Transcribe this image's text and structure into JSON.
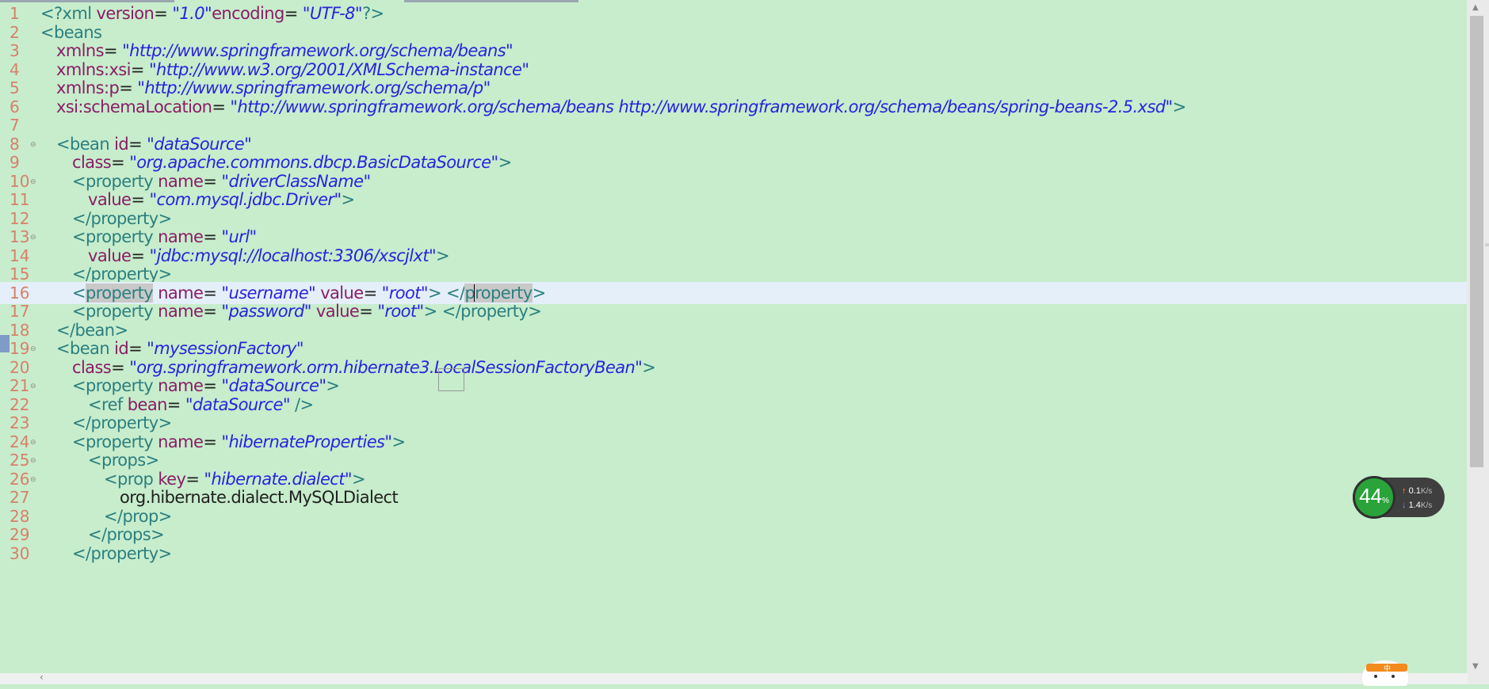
{
  "editor": {
    "lines": [
      {
        "n": "1",
        "fold": false,
        "current": false,
        "indent": 0,
        "tokens": [
          [
            "t",
            "<?xml "
          ],
          [
            "a",
            "version"
          ],
          [
            "x",
            "= "
          ],
          [
            "v",
            "\"1.0\""
          ],
          [
            "a",
            "encoding"
          ],
          [
            "x",
            "= "
          ],
          [
            "v",
            "\"UTF-8\""
          ],
          [
            "t",
            "?>"
          ]
        ]
      },
      {
        "n": "2",
        "fold": false,
        "current": false,
        "indent": 0,
        "tokens": [
          [
            "t",
            "<beans"
          ]
        ]
      },
      {
        "n": "3",
        "fold": false,
        "current": false,
        "indent": 1,
        "tokens": [
          [
            "a",
            "xmlns"
          ],
          [
            "x",
            "= "
          ],
          [
            "v",
            "\"http://www.springframework.org/schema/beans\""
          ]
        ]
      },
      {
        "n": "4",
        "fold": false,
        "current": false,
        "indent": 1,
        "tokens": [
          [
            "a",
            "xmlns:xsi"
          ],
          [
            "x",
            "= "
          ],
          [
            "v",
            "\"http://www.w3.org/2001/XMLSchema-instance\""
          ]
        ]
      },
      {
        "n": "5",
        "fold": false,
        "current": false,
        "indent": 1,
        "tokens": [
          [
            "a",
            "xmlns:p"
          ],
          [
            "x",
            "= "
          ],
          [
            "v",
            "\"http://www.springframework.org/schema/p\""
          ]
        ]
      },
      {
        "n": "6",
        "fold": false,
        "current": false,
        "indent": 1,
        "tokens": [
          [
            "a",
            "xsi:schemaLocation"
          ],
          [
            "x",
            "= "
          ],
          [
            "v",
            "\"http://www.springframework.org/schema/beans http://www.springframework.org/schema/beans/spring-beans-2.5.xsd\""
          ],
          [
            "t",
            ">"
          ]
        ]
      },
      {
        "n": "7",
        "fold": false,
        "current": false,
        "indent": 0,
        "tokens": []
      },
      {
        "n": "8",
        "fold": true,
        "current": false,
        "indent": 1,
        "tokens": [
          [
            "t",
            "<bean "
          ],
          [
            "a",
            "id"
          ],
          [
            "x",
            "= "
          ],
          [
            "v",
            "\"dataSource\""
          ]
        ]
      },
      {
        "n": "9",
        "fold": false,
        "current": false,
        "indent": 2,
        "tokens": [
          [
            "a",
            "class"
          ],
          [
            "x",
            "= "
          ],
          [
            "v",
            "\"org.apache.commons.dbcp.BasicDataSource\""
          ],
          [
            "t",
            ">"
          ]
        ]
      },
      {
        "n": "10",
        "fold": true,
        "current": false,
        "indent": 2,
        "tokens": [
          [
            "t",
            "<property "
          ],
          [
            "a",
            "name"
          ],
          [
            "x",
            "= "
          ],
          [
            "v",
            "\"driverClassName\""
          ]
        ]
      },
      {
        "n": "11",
        "fold": false,
        "current": false,
        "indent": 3,
        "tokens": [
          [
            "a",
            "value"
          ],
          [
            "x",
            "= "
          ],
          [
            "v",
            "\"com.mysql.jdbc.Driver\""
          ],
          [
            "t",
            ">"
          ]
        ]
      },
      {
        "n": "12",
        "fold": false,
        "current": false,
        "indent": 2,
        "tokens": [
          [
            "t",
            "</property>"
          ]
        ]
      },
      {
        "n": "13",
        "fold": true,
        "current": false,
        "indent": 2,
        "tokens": [
          [
            "t",
            "<property "
          ],
          [
            "a",
            "name"
          ],
          [
            "x",
            "= "
          ],
          [
            "v",
            "\"url\""
          ]
        ]
      },
      {
        "n": "14",
        "fold": false,
        "current": false,
        "indent": 3,
        "tokens": [
          [
            "a",
            "value"
          ],
          [
            "x",
            "= "
          ],
          [
            "v",
            "\"jdbc:mysql://localhost:3306/xscjlxt\""
          ],
          [
            "t",
            ">"
          ]
        ]
      },
      {
        "n": "15",
        "fold": false,
        "current": false,
        "indent": 2,
        "tokens": [
          [
            "t",
            "</property>"
          ]
        ]
      },
      {
        "n": "16",
        "fold": false,
        "current": true,
        "indent": 2,
        "tokens": [
          [
            "t",
            "<"
          ],
          [
            "th",
            "property"
          ],
          [
            "t",
            " "
          ],
          [
            "a",
            "name"
          ],
          [
            "x",
            "= "
          ],
          [
            "v",
            "\"username\""
          ],
          [
            "t",
            " "
          ],
          [
            "a",
            "value"
          ],
          [
            "x",
            "= "
          ],
          [
            "v",
            "\"root\""
          ],
          [
            "t",
            "> </"
          ],
          [
            "th",
            "p"
          ],
          [
            "caret",
            ""
          ],
          [
            "th",
            "roperty"
          ],
          [
            "t",
            ">"
          ]
        ]
      },
      {
        "n": "17",
        "fold": false,
        "current": false,
        "indent": 2,
        "tokens": [
          [
            "t",
            "<property "
          ],
          [
            "a",
            "name"
          ],
          [
            "x",
            "= "
          ],
          [
            "v",
            "\"password\""
          ],
          [
            "t",
            " "
          ],
          [
            "a",
            "value"
          ],
          [
            "x",
            "= "
          ],
          [
            "v",
            "\"root\""
          ],
          [
            "t",
            "> </property>"
          ]
        ]
      },
      {
        "n": "18",
        "fold": false,
        "current": false,
        "indent": 1,
        "tokens": [
          [
            "t",
            "</bean>"
          ]
        ]
      },
      {
        "n": "19",
        "fold": true,
        "current": false,
        "indent": 1,
        "tokens": [
          [
            "t",
            "<bean "
          ],
          [
            "a",
            "id"
          ],
          [
            "x",
            "= "
          ],
          [
            "v",
            "\"mysessionFactory\""
          ]
        ]
      },
      {
        "n": "20",
        "fold": false,
        "current": false,
        "indent": 2,
        "tokens": [
          [
            "a",
            "class"
          ],
          [
            "x",
            "= "
          ],
          [
            "v",
            "\"org.springframework.orm.hibernate3.LocalSessionFactoryBean\""
          ],
          [
            "t",
            ">"
          ]
        ]
      },
      {
        "n": "21",
        "fold": true,
        "current": false,
        "indent": 2,
        "tokens": [
          [
            "t",
            "<property "
          ],
          [
            "a",
            "name"
          ],
          [
            "x",
            "= "
          ],
          [
            "v",
            "\"dataSource\""
          ],
          [
            "t",
            ">"
          ]
        ]
      },
      {
        "n": "22",
        "fold": false,
        "current": false,
        "indent": 3,
        "tokens": [
          [
            "t",
            "<ref "
          ],
          [
            "a",
            "bean"
          ],
          [
            "x",
            "= "
          ],
          [
            "v",
            "\"dataSource\""
          ],
          [
            "t",
            " />"
          ]
        ]
      },
      {
        "n": "23",
        "fold": false,
        "current": false,
        "indent": 2,
        "tokens": [
          [
            "t",
            "</property>"
          ]
        ]
      },
      {
        "n": "24",
        "fold": true,
        "current": false,
        "indent": 2,
        "tokens": [
          [
            "t",
            "<property "
          ],
          [
            "a",
            "name"
          ],
          [
            "x",
            "= "
          ],
          [
            "v",
            "\"hibernateProperties\""
          ],
          [
            "t",
            ">"
          ]
        ]
      },
      {
        "n": "25",
        "fold": true,
        "current": false,
        "indent": 3,
        "tokens": [
          [
            "t",
            "<props>"
          ]
        ]
      },
      {
        "n": "26",
        "fold": true,
        "current": false,
        "indent": 4,
        "tokens": [
          [
            "t",
            "<prop "
          ],
          [
            "a",
            "key"
          ],
          [
            "x",
            "= "
          ],
          [
            "v",
            "\"hibernate.dialect\""
          ],
          [
            "t",
            ">"
          ]
        ]
      },
      {
        "n": "27",
        "fold": false,
        "current": false,
        "indent": 5,
        "tokens": [
          [
            "x",
            "org.hibernate.dialect.MySQLDialect"
          ]
        ]
      },
      {
        "n": "28",
        "fold": false,
        "current": false,
        "indent": 4,
        "tokens": [
          [
            "t",
            "</prop>"
          ]
        ]
      },
      {
        "n": "29",
        "fold": false,
        "current": false,
        "indent": 3,
        "tokens": [
          [
            "t",
            "</props>"
          ]
        ]
      },
      {
        "n": "30",
        "fold": false,
        "current": false,
        "indent": 2,
        "tokens": [
          [
            "t",
            "</property>"
          ]
        ]
      }
    ]
  },
  "net_monitor": {
    "percent": "44",
    "percent_unit": "%",
    "upload": "0.1",
    "download": "1.4",
    "unit": "K/s",
    "ring_color": "#2aa33a"
  },
  "icons": {
    "fold": "fold-minus-icon",
    "drag": "drag-handle-icon",
    "mascot": "mascot-icon"
  },
  "colors": {
    "background": "#c7edcc",
    "current_line": "#e4eff9",
    "tag": "#2c7f7f",
    "attribute": "#8a1d66",
    "value": "#2a22e0",
    "line_number": "#d8806a"
  }
}
